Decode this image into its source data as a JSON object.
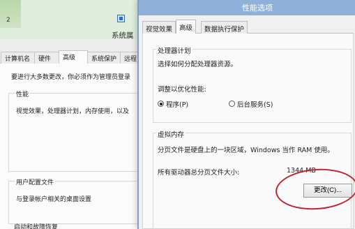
{
  "background_window": {
    "number": "2",
    "title": "系统属",
    "tabs": [
      {
        "label": "计算机名"
      },
      {
        "label": "硬件"
      },
      {
        "label": "高级"
      },
      {
        "label": "系统保护"
      },
      {
        "label": "远程"
      }
    ],
    "message": "要进行大多数更改，你必须作为管理员登录",
    "performance_title": "性能",
    "performance_text": "视觉效果，处理器计划，内存使用，以及",
    "user_profile_title": "用户配置文件",
    "user_profile_text": "与登录帐户相关的桌面设置",
    "startup_title": "启动和故障恢复"
  },
  "dialog": {
    "title": "性能选项",
    "tabs": [
      {
        "label": "视觉效果"
      },
      {
        "label": "高级"
      },
      {
        "label": "数据执行保护"
      }
    ],
    "processor": {
      "title": "处理器计划",
      "description": "选择如何分配处理器资源。",
      "optimize_label": "调整以优化性能:",
      "option_programs": "程序(P)",
      "option_background": "后台服务(S)",
      "selected": "程序(P)"
    },
    "virtual_memory": {
      "title": "虚拟内存",
      "description": "分页文件是硬盘上的一块区域，Windows 当作 RAM 使用。",
      "total_label": "所有驱动器总分页文件大小:",
      "total_value": "1344 MB",
      "change_button": "更改(C)..."
    }
  },
  "colors": {
    "highlight_circle": "#c0242c",
    "dialog_titlebar": "#8fb1d9"
  }
}
